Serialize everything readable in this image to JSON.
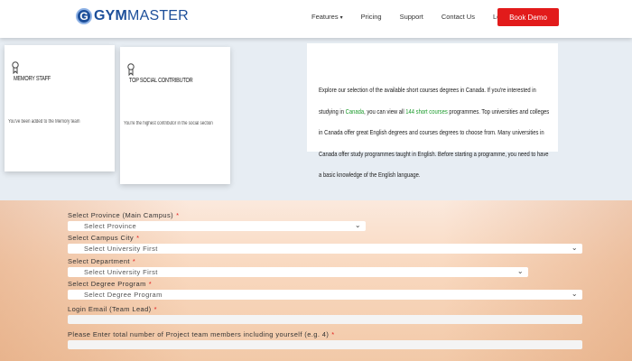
{
  "header": {
    "logo_mark": "G",
    "logo_bold": "GYM",
    "logo_light": "MASTER",
    "nav": [
      "Features",
      "Pricing",
      "Support",
      "Contact Us",
      "Login"
    ],
    "features_caret": "▾",
    "book_demo": "Book Demo"
  },
  "cards": [
    {
      "title": "MEMORY STAFF",
      "desc": "You've been added to the Memory team"
    },
    {
      "title": "TOP SOCIAL CONTRIBUTOR",
      "desc": "You're the highest contributor in the social section"
    }
  ],
  "paragraph": {
    "p1": "Explore our selection of the available short courses degrees in Canada. If you're interested in studying in ",
    "p1_link": "Canada",
    "p2": ", you can view all ",
    "p2_link": "144 short courses",
    "p3": " programmes. Top universities and colleges in Canada offer great English degrees and courses degrees to choose from. Many universities in Canada offer study programmes taught in English. Before starting a programme, you need to have a basic knowledge of the English language."
  },
  "form": {
    "province_label": "Select Province (Main Campus)",
    "province_value": "Select Province",
    "city_label": "Select Campus City",
    "city_value": "Select University First",
    "department_label": "Select Department",
    "department_value": "Select University First",
    "degree_label": "Select Degree Program",
    "degree_value": "Select Degree Program",
    "email_label": "Login Email (Team Lead)",
    "members_label": "Please Enter total number of Project team members including yourself (e.g. 4)",
    "required_mark": "*",
    "chevron": "⌄"
  },
  "colors": {
    "brand": "#1d4f9a",
    "accent": "#e21b1b",
    "highlight": "#1a9a2a"
  }
}
